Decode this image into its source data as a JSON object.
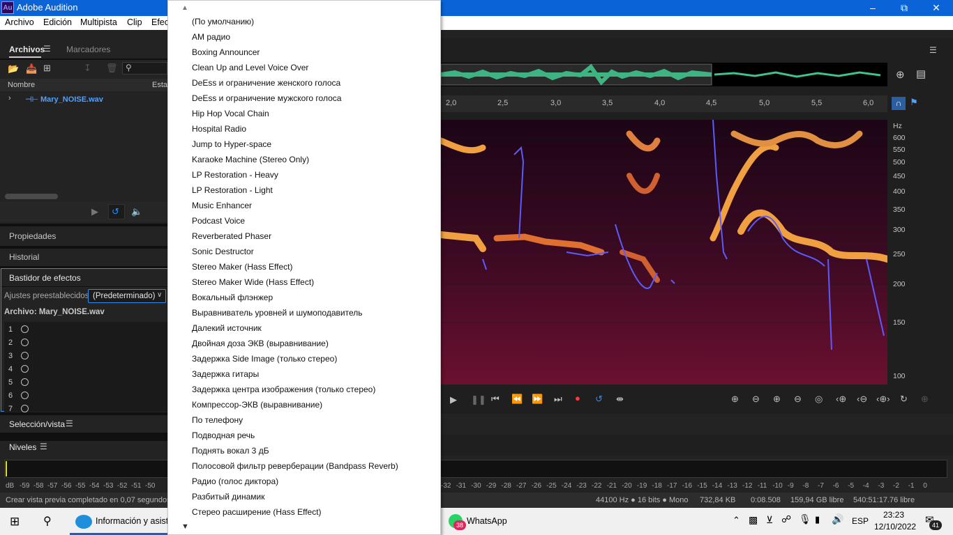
{
  "window": {
    "title": "Adobe Audition",
    "logo": "Au"
  },
  "menubar": [
    "Archivo",
    "Edición",
    "Multipista",
    "Clip",
    "Efec"
  ],
  "files_panel": {
    "tabs": [
      "Archivos",
      "Marcadores"
    ],
    "columns": [
      "Nombre",
      "Esta"
    ],
    "file": "Mary_NOISE.wav"
  },
  "sections": {
    "properties": "Propiedades",
    "history": "Historial",
    "rack": "Bastidor de efectos",
    "selection": "Selección/vista",
    "levels": "Niveles"
  },
  "rack": {
    "presets_label": "Ajustes preestablecidos:",
    "preset_value": "(Predeterminado)",
    "file_label": "Archivo: Mary_NOISE.wav",
    "slots": [
      "1",
      "2",
      "3",
      "4",
      "5",
      "6",
      "7"
    ]
  },
  "dropdown_items": [
    "(По умолчанию)",
    "AM радио",
    "Boxing Announcer",
    "Clean Up and Level Voice Over",
    "DeEss и ограничение женского голоса",
    "DeEss и ограничение мужского голоса",
    "Hip Hop Vocal Chain",
    "Hospital Radio",
    "Jump to Hyper-space",
    "Karaoke Machine (Stereo Only)",
    "LP Restoration - Heavy",
    "LP Restoration - Light",
    "Music Enhancer",
    "Podcast Voice",
    "Reverberated Phaser",
    "Sonic Destructor",
    "Stereo Maker (Hass Effect)",
    "Stereo Maker Wide (Hass Effect)",
    "Вокальный флэнжер",
    "Выравниватель уровней и шумоподавитель",
    "Далекий источник",
    "Двойная доза ЭКВ (выравнивание)",
    "Задержка Side Image (только стерео)",
    "Задержка гитары",
    "Задержка центра изображения (только стерео)",
    "Компрессор-ЭКВ (выравнивание)",
    "По телефону",
    "Подводная речь",
    "Поднять вокал 3 дБ",
    "Полосовой фильтр реверберации (Bandpass Reverb)",
    "Радио (голос диктора)",
    "Разбитый динамик",
    "Стерео расширение (Hass Effect)"
  ],
  "ruler": [
    "2,0",
    "2,5",
    "3,0",
    "3,5",
    "4,0",
    "4,5",
    "5,0",
    "5,5",
    "6,0"
  ],
  "hz_axis": [
    "Hz",
    "600",
    "550",
    "500",
    "450",
    "400",
    "350",
    "300",
    "250",
    "200",
    "150",
    "100"
  ],
  "db_scale": [
    "dB",
    "-59",
    "-58",
    "-57",
    "-56",
    "-55",
    "-54",
    "-53",
    "-52",
    "-51",
    "-50",
    "-32",
    "-31",
    "-30",
    "-29",
    "-28",
    "-27",
    "-26",
    "-25",
    "-24",
    "-23",
    "-22",
    "-21",
    "-20",
    "-19",
    "-18",
    "-17",
    "-16",
    "-15",
    "-14",
    "-13",
    "-12",
    "-11",
    "-10",
    "-9",
    "-8",
    "-7",
    "-6",
    "-5",
    "-4",
    "-3",
    "-2",
    "-1",
    "0"
  ],
  "status": {
    "left": "Crear vista previa completado en 0,07 segundos",
    "format": "44100 Hz ● 16 bits ● Mono",
    "size": "732,84 KB",
    "duration": "0:08.508",
    "free": "159,94 GB libre",
    "free_time": "540:51:17.76 libre"
  },
  "taskbar": {
    "edge_label": "Información y asist.",
    "whatsapp": "WhatsApp",
    "whatsapp_badge": "38",
    "lang": "ESP",
    "time": "23:23",
    "date": "12/10/2022",
    "notif": "41"
  },
  "colors": {
    "titlebar": "#0a64d8",
    "accent": "#2c8cf0",
    "waveform": "#3fc38c",
    "spectrogram_bg": "#2a0818",
    "pitch_line": "#5b5bff"
  }
}
